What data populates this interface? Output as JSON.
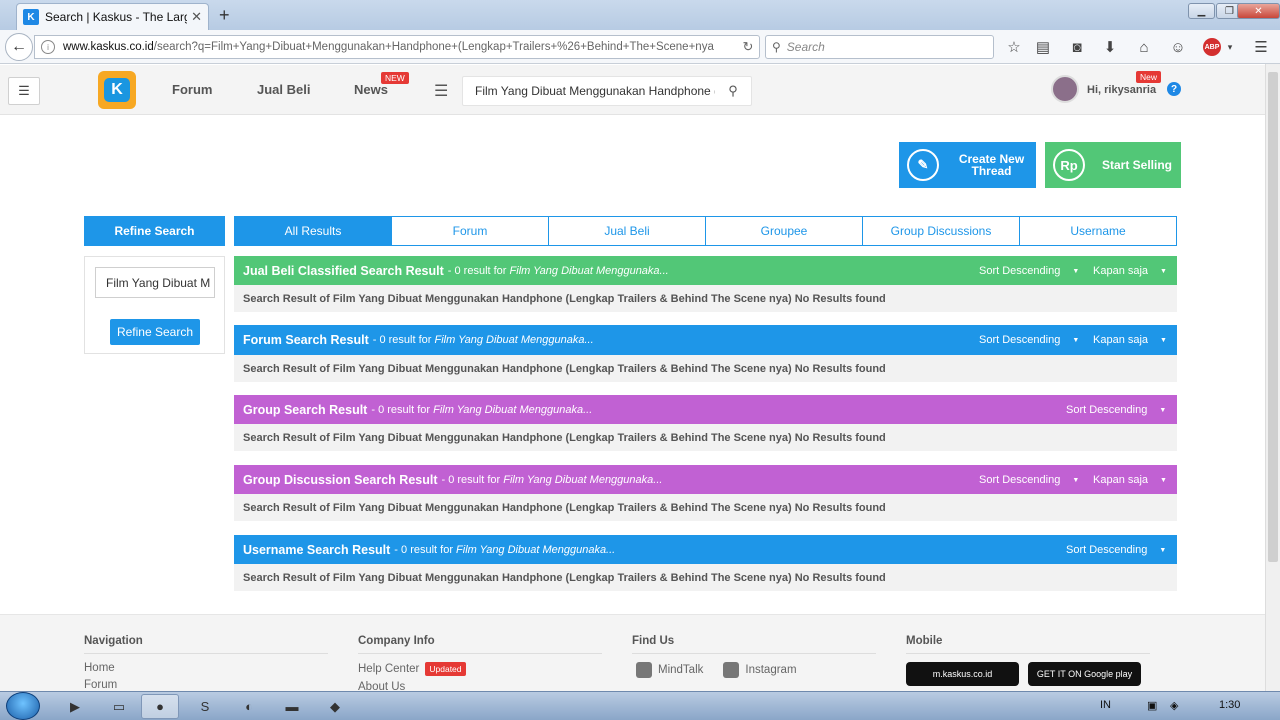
{
  "browser": {
    "tab_title": "Search | Kaskus - The Large...",
    "tab_favicon": "K",
    "url_host": "www.kaskus.co.id",
    "url_path": "/search?q=Film+Yang+Dibuat+Menggunakan+Handphone+(Lengkap+Trailers+%26+Behind+The+Scene+nya",
    "search_placeholder": "Search"
  },
  "header": {
    "nav": [
      {
        "label": "Forum"
      },
      {
        "label": "Jual Beli"
      },
      {
        "label": "News",
        "badge": "NEW"
      }
    ],
    "search_value": "Film Yang Dibuat Menggunakan Handphone ( L",
    "user_greeting": "Hi, rikysanria",
    "user_badge": "New"
  },
  "actions": {
    "create_thread": "Create New Thread",
    "start_selling": "Start Selling",
    "rp_symbol": "Rp"
  },
  "refine": {
    "heading": "Refine Search",
    "input_value": "Film Yang Dibuat M",
    "button": "Refine Search"
  },
  "tabs": [
    "All Results",
    "Forum",
    "Jual Beli",
    "Groupee",
    "Group Discussions",
    "Username"
  ],
  "sections": [
    {
      "title": "Jual Beli Classified Search Result",
      "count_text": "- 0 result for",
      "query": "Film Yang Dibuat Menggunaka...",
      "sort": "Sort Descending",
      "time": "Kapan saja",
      "color": "#52c777",
      "body": "Search Result of Film Yang Dibuat Menggunakan Handphone (Lengkap Trailers & Behind The Scene nya) No Results found"
    },
    {
      "title": "Forum Search Result",
      "count_text": "- 0 result for",
      "query": "Film Yang Dibuat Menggunaka...",
      "sort": "Sort Descending",
      "time": "Kapan saja",
      "color": "#1e96e8",
      "body": "Search Result of Film Yang Dibuat Menggunakan Handphone (Lengkap Trailers & Behind The Scene nya) No Results found"
    },
    {
      "title": "Group Search Result",
      "count_text": "- 0 result for",
      "query": "Film Yang Dibuat Menggunaka...",
      "sort": "Sort Descending",
      "time": "",
      "color": "#c161d3",
      "body": "Search Result of Film Yang Dibuat Menggunakan Handphone (Lengkap Trailers & Behind The Scene nya) No Results found"
    },
    {
      "title": "Group Discussion Search Result",
      "count_text": "- 0 result for",
      "query": "Film Yang Dibuat Menggunaka...",
      "sort": "Sort Descending",
      "time": "Kapan saja",
      "color": "#c161d3",
      "body": "Search Result of Film Yang Dibuat Menggunakan Handphone (Lengkap Trailers & Behind The Scene nya) No Results found"
    },
    {
      "title": "Username Search Result",
      "count_text": "- 0 result for",
      "query": "Film Yang Dibuat Menggunaka...",
      "sort": "Sort Descending",
      "time": "",
      "color": "#1e96e8",
      "body": "Search Result of Film Yang Dibuat Menggunakan Handphone (Lengkap Trailers & Behind The Scene nya) No Results found"
    }
  ],
  "footer": {
    "navigation": {
      "heading": "Navigation",
      "links": [
        "Home",
        "Forum"
      ]
    },
    "company": {
      "heading": "Company Info",
      "links": [
        "Help Center",
        "About Us"
      ],
      "updated_badge": "Updated"
    },
    "findus": {
      "heading": "Find Us",
      "links": [
        "MindTalk",
        "Instagram"
      ]
    },
    "mobile": {
      "heading": "Mobile",
      "mobile_site": "m.kaskus.co.id",
      "google_play": "GET IT ON Google play"
    }
  },
  "taskbar": {
    "lang": "IN",
    "time": "1:30"
  }
}
